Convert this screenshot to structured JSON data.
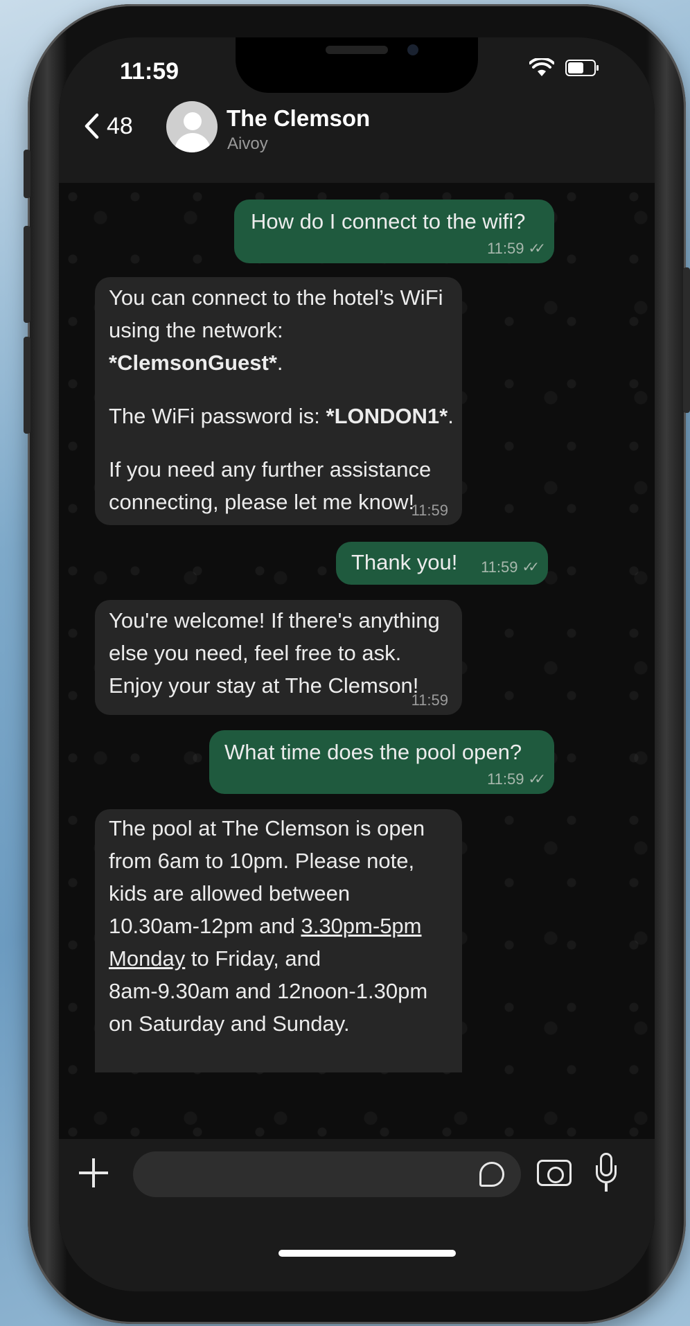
{
  "status_bar": {
    "time": "11:59"
  },
  "header": {
    "back_count": "48",
    "contact_name": "The Clemson",
    "contact_subtitle": "Aivoy"
  },
  "messages": [
    {
      "direction": "outgoing",
      "text": "How do I connect to the wifi?",
      "time": "11:59",
      "status": "read"
    },
    {
      "direction": "incoming",
      "lines": {
        "l1": "You can connect to the hotel’s WiFi",
        "l2": "using the network:",
        "l3_bold": "*ClemsonGuest*",
        "l3_end": ".",
        "l4_pre": "The WiFi password is: ",
        "l4_bold": "*LONDON1*",
        "l4_end": ".",
        "l5": "If you need any further assistance",
        "l6": "connecting, please let me know!"
      },
      "time": "11:59"
    },
    {
      "direction": "outgoing",
      "text": "Thank you!",
      "time": "11:59",
      "status": "read"
    },
    {
      "direction": "incoming",
      "lines": {
        "l1": "You're welcome! If there's anything",
        "l2": "else you need, feel free to ask.",
        "l3": "Enjoy your stay at The Clemson!"
      },
      "time": "11:59"
    },
    {
      "direction": "outgoing",
      "text": "What time does the pool open?",
      "time": "11:59",
      "status": "read"
    },
    {
      "direction": "incoming",
      "lines": {
        "l1": "The pool at The Clemson is open",
        "l2": "from 6am to 10pm. Please note,",
        "l3": "kids are allowed between",
        "l4_pre": "10.30am-12pm and ",
        "l4_link": "3.30pm-5pm",
        "l5_link": "Monday",
        "l5_post": " to Friday, and",
        "l6": "8am-9.30am and 12noon-1.30pm",
        "l7": "on Saturday and Sunday."
      }
    }
  ],
  "colors": {
    "outgoing_bubble": "#1f5a3e",
    "incoming_bubble": "#262626",
    "header_bg": "#1b1b1b"
  }
}
